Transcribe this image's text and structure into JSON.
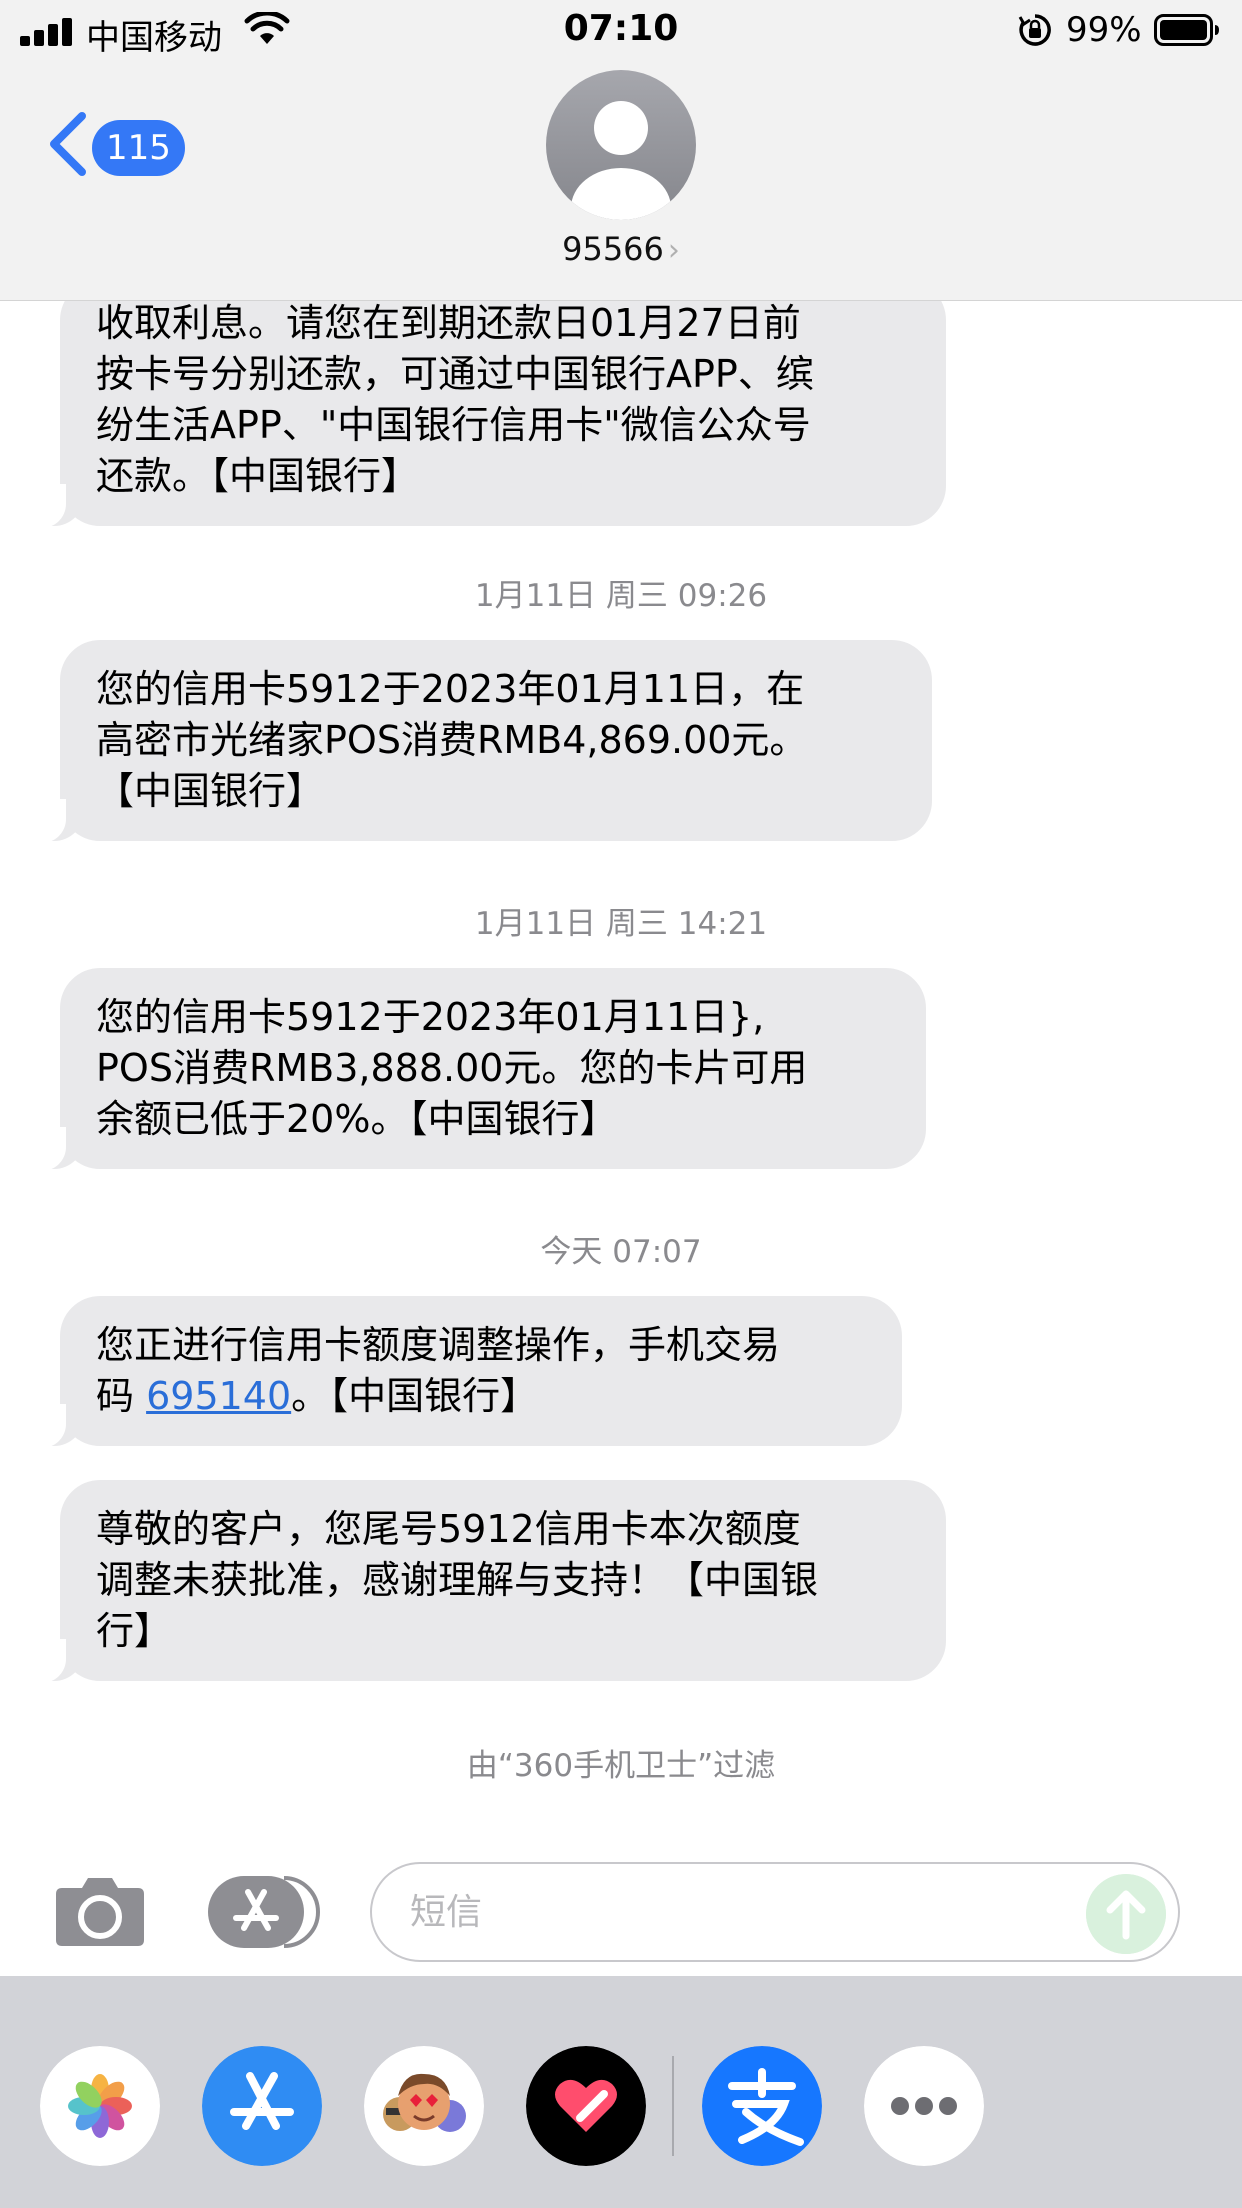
{
  "status_bar": {
    "carrier": "中国移动",
    "time": "07:10",
    "battery_percent": "99%",
    "signal_bars": 4,
    "icons": [
      "signal-icon",
      "wifi-icon",
      "orientation-lock-icon",
      "battery-icon"
    ]
  },
  "header": {
    "back_badge_count": "115",
    "contact_name": "95566",
    "contact_chevron": "›"
  },
  "messages": [
    {
      "lines": [
        "收取利息。请您在到期还款日01月27日前",
        "按卡号分别还款，可通过中国银行APP、缤",
        "纷生活APP、\"中国银行信用卡\"微信公众号",
        "还款。【中国银行】"
      ]
    },
    {
      "timestamp": "1月11日 周三 09:26",
      "lines": [
        "您的信用卡5912于2023年01月11日，在",
        "高密市光绪家POS消费RMB4,869.00元。",
        "【中国银行】"
      ]
    },
    {
      "timestamp": "1月11日 周三 14:21",
      "lines": [
        "您的信用卡5912于2023年01月11日},",
        "POS消费RMB3,888.00元。您的卡片可用",
        "余额已低于20%。【中国银行】"
      ]
    },
    {
      "timestamp": "今天 07:07",
      "line1": "您正进行信用卡额度调整操作，手机交易",
      "line2_prefix": "码 ",
      "code": "695140",
      "line2_suffix": "。【中国银行】"
    },
    {
      "lines": [
        "尊敬的客户，您尾号5912信用卡本次额度",
        "调整未获批准，感谢理解与支持！【中国银",
        "行】"
      ]
    }
  ],
  "filter_note": "由“360手机卫士”过滤",
  "input": {
    "placeholder": "短信"
  },
  "app_drawer": {
    "apps": [
      "photos-icon",
      "app-store-icon",
      "memoji-icon",
      "digital-touch-icon",
      "alipay-icon",
      "more-icon"
    ],
    "accent_colors": {
      "imessage_blue": "#3478f6",
      "alipay_blue": "#1677ff",
      "send_green": "#d9f1dd"
    }
  }
}
